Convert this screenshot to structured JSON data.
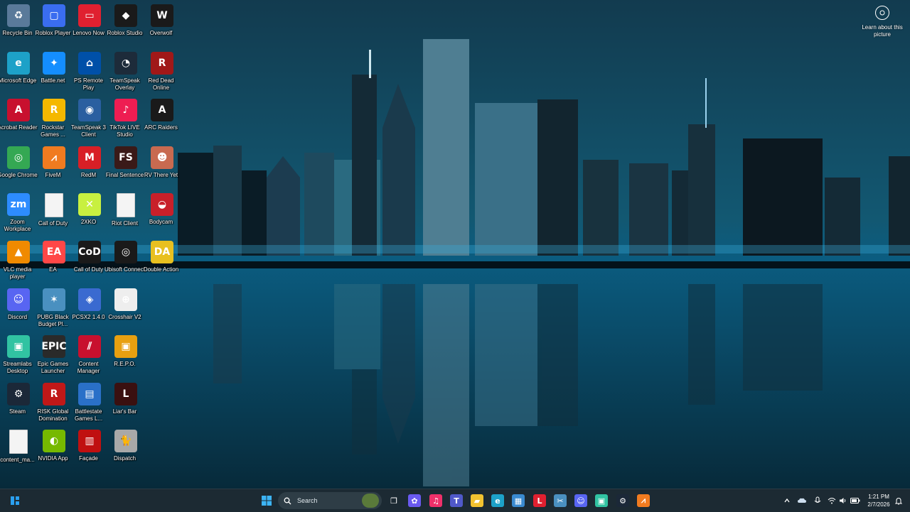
{
  "desktop": {
    "icons": [
      {
        "label": "Recycle Bin",
        "icon": "recycle-bin-icon",
        "color": "#5a7a9a",
        "glyph": "♻"
      },
      {
        "label": "Roblox Player",
        "icon": "roblox-icon",
        "color": "#3a6df0",
        "glyph": "▢"
      },
      {
        "label": "Lenovo Now",
        "icon": "lenovo-icon",
        "color": "#e02030",
        "glyph": "▭"
      },
      {
        "label": "Roblox Studio",
        "icon": "roblox-studio-icon",
        "color": "#1a1a1a",
        "glyph": "◆"
      },
      {
        "label": "Overwolf",
        "icon": "overwolf-icon",
        "color": "#1a1a1a",
        "glyph": "W"
      },
      {
        "label": "Microsoft Edge",
        "icon": "edge-icon",
        "color": "#1da1c8",
        "glyph": "e"
      },
      {
        "label": "Battle.net",
        "icon": "battlenet-icon",
        "color": "#148eff",
        "glyph": "✦"
      },
      {
        "label": "PS Remote Play",
        "icon": "ps-remote-icon",
        "color": "#0050a8",
        "glyph": "⌂"
      },
      {
        "label": "TeamSpeak Overlay",
        "icon": "teamspeak-overlay-icon",
        "color": "#1d2b3a",
        "glyph": "◔"
      },
      {
        "label": "Red Dead Online",
        "icon": "red-dead-icon",
        "color": "#a01818",
        "glyph": "R"
      },
      {
        "label": "Acrobat Reader",
        "icon": "acrobat-icon",
        "color": "#c8102e",
        "glyph": "A"
      },
      {
        "label": "Rockstar Games ...",
        "icon": "rockstar-icon",
        "color": "#f5b800",
        "glyph": "R"
      },
      {
        "label": "TeamSpeak 3 Client",
        "icon": "teamspeak-icon",
        "color": "#2a5fa0",
        "glyph": "◉"
      },
      {
        "label": "TikTok LIVE Studio",
        "icon": "tiktok-icon",
        "color": "#ee1d52",
        "glyph": "♪"
      },
      {
        "label": "ARC Raiders",
        "icon": "arc-raiders-icon",
        "color": "#1a1a1a",
        "glyph": "A"
      },
      {
        "label": "Google Chrome",
        "icon": "chrome-icon",
        "color": "#34a853",
        "glyph": "◎"
      },
      {
        "label": "FiveM",
        "icon": "fivem-icon",
        "color": "#f07b20",
        "glyph": "⩘"
      },
      {
        "label": "RedM",
        "icon": "redm-icon",
        "color": "#d81f26",
        "glyph": "M"
      },
      {
        "label": "Final Sentence",
        "icon": "final-sentence-icon",
        "color": "#3a1a18",
        "glyph": "FS"
      },
      {
        "label": "RV There Yet",
        "icon": "rv-there-yet-icon",
        "color": "#c86a50",
        "glyph": "☻"
      },
      {
        "label": "Zoom Workplace",
        "icon": "zoom-icon",
        "color": "#2d8cff",
        "glyph": "zm"
      },
      {
        "label": "Call of Duty",
        "icon": "file-icon",
        "color": "#f4f4f4",
        "glyph": ""
      },
      {
        "label": "2XKO",
        "icon": "2xko-icon",
        "color": "#c8f040",
        "glyph": "✕"
      },
      {
        "label": "Riot Client",
        "icon": "file-icon",
        "color": "#f4f4f4",
        "glyph": ""
      },
      {
        "label": "Bodycam",
        "icon": "bodycam-icon",
        "color": "#c8202a",
        "glyph": "◒"
      },
      {
        "label": "VLC media player",
        "icon": "vlc-icon",
        "color": "#f08a00",
        "glyph": "▲"
      },
      {
        "label": "EA",
        "icon": "ea-icon",
        "color": "#ff4747",
        "glyph": "EA"
      },
      {
        "label": "Call of Duty",
        "icon": "call-of-duty-icon",
        "color": "#1a1a1a",
        "glyph": "CoD"
      },
      {
        "label": "Ubisoft Connect",
        "icon": "ubisoft-icon",
        "color": "#1a1a1a",
        "glyph": "◎"
      },
      {
        "label": "Double Action",
        "icon": "double-action-icon",
        "color": "#e8c020",
        "glyph": "DA"
      },
      {
        "label": "Discord",
        "icon": "discord-icon",
        "color": "#5865f2",
        "glyph": "☺"
      },
      {
        "label": "PUBG Black Budget Pl...",
        "icon": "pubg-icon",
        "color": "#4a90c0",
        "glyph": "✶"
      },
      {
        "label": "PCSX2 1.4.0",
        "icon": "pcsx2-icon",
        "color": "#3a6ad0",
        "glyph": "◈"
      },
      {
        "label": "Crosshair V2",
        "icon": "crosshair-icon",
        "color": "#eeeeee",
        "glyph": "⊕"
      },
      {
        "label": "",
        "icon": "blank-slot",
        "color": "transparent",
        "glyph": ""
      },
      {
        "label": "Streamlabs Desktop",
        "icon": "streamlabs-icon",
        "color": "#31c3a2",
        "glyph": "▣"
      },
      {
        "label": "Epic Games Launcher",
        "icon": "epic-games-icon",
        "color": "#2a2a2a",
        "glyph": "EPIC"
      },
      {
        "label": "Content Manager",
        "icon": "content-manager-icon",
        "color": "#c8102e",
        "glyph": "⫽"
      },
      {
        "label": "R.E.P.O.",
        "icon": "repo-icon",
        "color": "#e8a010",
        "glyph": "▣"
      },
      {
        "label": "",
        "icon": "blank-slot",
        "color": "transparent",
        "glyph": ""
      },
      {
        "label": "Steam",
        "icon": "steam-icon",
        "color": "#1b2838",
        "glyph": "⚙"
      },
      {
        "label": "RISK Global Domination",
        "icon": "risk-icon",
        "color": "#c01818",
        "glyph": "R"
      },
      {
        "label": "Battlestate Games L...",
        "icon": "battlestate-icon",
        "color": "#2a70c8",
        "glyph": "▤"
      },
      {
        "label": "Liar's Bar",
        "icon": "liars-bar-icon",
        "color": "#3a1010",
        "glyph": "L"
      },
      {
        "label": "",
        "icon": "blank-slot",
        "color": "transparent",
        "glyph": ""
      },
      {
        "label": "content_ma...",
        "icon": "file-icon",
        "color": "#f4f4f4",
        "glyph": ""
      },
      {
        "label": "NVIDIA App",
        "icon": "nvidia-icon",
        "color": "#76b900",
        "glyph": "◐"
      },
      {
        "label": "Façade",
        "icon": "facade-icon",
        "color": "#c01010",
        "glyph": "▥"
      },
      {
        "label": "Dispatch",
        "icon": "dispatch-icon",
        "color": "#a8a8a8",
        "glyph": "🐈"
      }
    ]
  },
  "learn_picture": {
    "label": "Learn about this picture",
    "icon": "camera-icon"
  },
  "taskbar": {
    "widgets_icon": "widgets-icon",
    "search": {
      "placeholder": "Search"
    },
    "apps": [
      {
        "name": "start-button",
        "glyph": "⊞",
        "color": "#2aa0f0"
      },
      {
        "name": "task-view-button",
        "glyph": "❐",
        "color": "transparent"
      },
      {
        "name": "copilot-button",
        "glyph": "✿",
        "color": "#6a5af0"
      },
      {
        "name": "music-button",
        "glyph": "♫",
        "color": "#f0306a"
      },
      {
        "name": "teams-button",
        "glyph": "T",
        "color": "#5059c9"
      },
      {
        "name": "file-explorer-button",
        "glyph": "▰",
        "color": "#f2c230"
      },
      {
        "name": "edge-button",
        "glyph": "e",
        "color": "#1da1c8"
      },
      {
        "name": "store-button",
        "glyph": "▦",
        "color": "#3a8ad0"
      },
      {
        "name": "lenovo-button",
        "glyph": "L",
        "color": "#e02030"
      },
      {
        "name": "snipping-button",
        "glyph": "✂",
        "color": "#4a90c0"
      },
      {
        "name": "discord-button",
        "glyph": "☺",
        "color": "#5865f2"
      },
      {
        "name": "streamlabs-button",
        "glyph": "▣",
        "color": "#31c3a2"
      },
      {
        "name": "steam-button",
        "glyph": "⚙",
        "color": "#1b2838"
      },
      {
        "name": "fivem-button",
        "glyph": "⩘",
        "color": "#f07b20"
      }
    ],
    "tray": {
      "chevron": "^",
      "clock_time": "1:21 PM",
      "clock_date": "2/7/2026"
    }
  }
}
